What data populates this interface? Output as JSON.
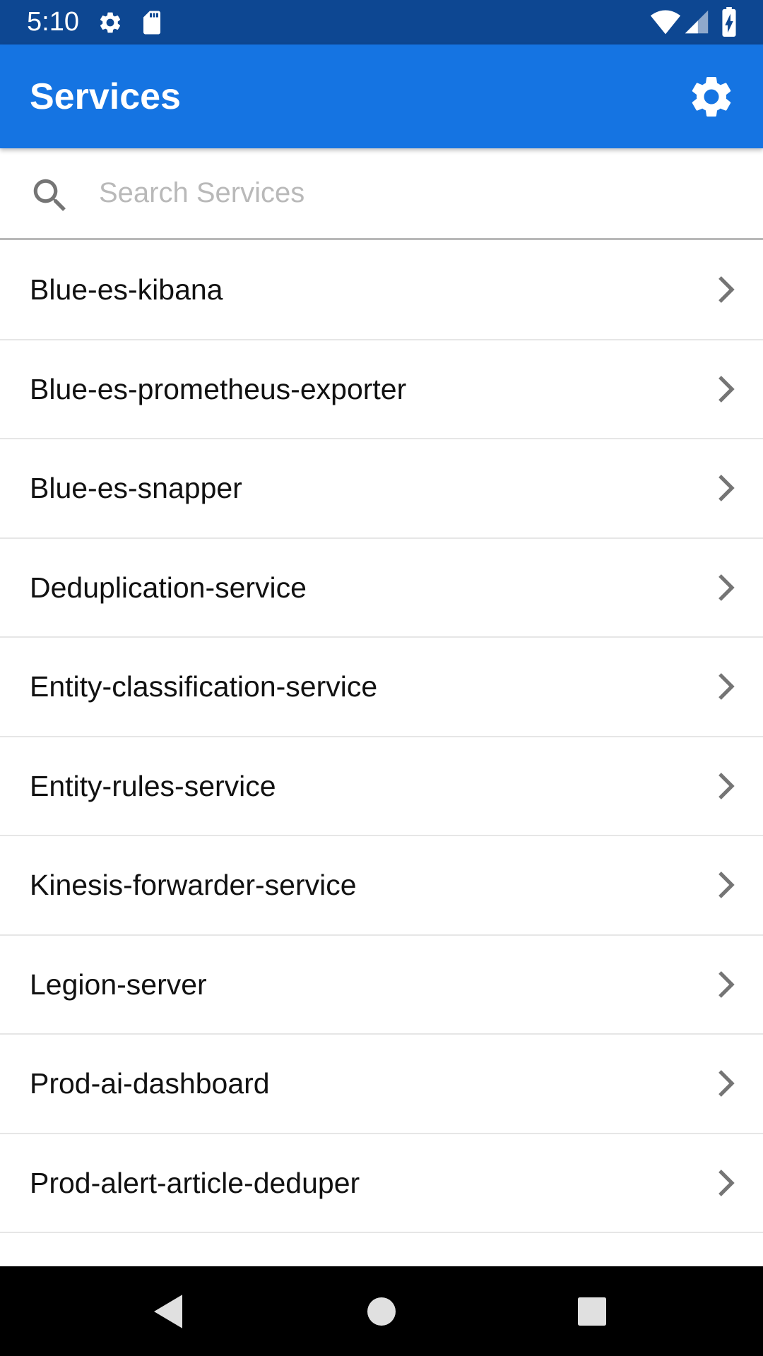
{
  "status_bar": {
    "time": "5:10",
    "left_icons": [
      "gear-icon",
      "sd-card-icon"
    ],
    "right_icons": [
      "wifi-icon",
      "signal-icon",
      "battery-charging-icon"
    ],
    "background": "#0d4792"
  },
  "app_bar": {
    "title": "Services",
    "action_icon": "gear-icon",
    "background": "#1574e2"
  },
  "search": {
    "placeholder": "Search Services",
    "value": "",
    "icon": "search-icon"
  },
  "services": [
    {
      "label": "Blue-es-kibana"
    },
    {
      "label": "Blue-es-prometheus-exporter"
    },
    {
      "label": "Blue-es-snapper"
    },
    {
      "label": "Deduplication-service"
    },
    {
      "label": "Entity-classification-service"
    },
    {
      "label": "Entity-rules-service"
    },
    {
      "label": "Kinesis-forwarder-service"
    },
    {
      "label": "Legion-server"
    },
    {
      "label": "Prod-ai-dashboard"
    },
    {
      "label": "Prod-alert-article-deduper"
    },
    {
      "label": ""
    }
  ],
  "nav_bar": {
    "buttons": [
      "back-icon",
      "home-icon",
      "recents-icon"
    ]
  }
}
